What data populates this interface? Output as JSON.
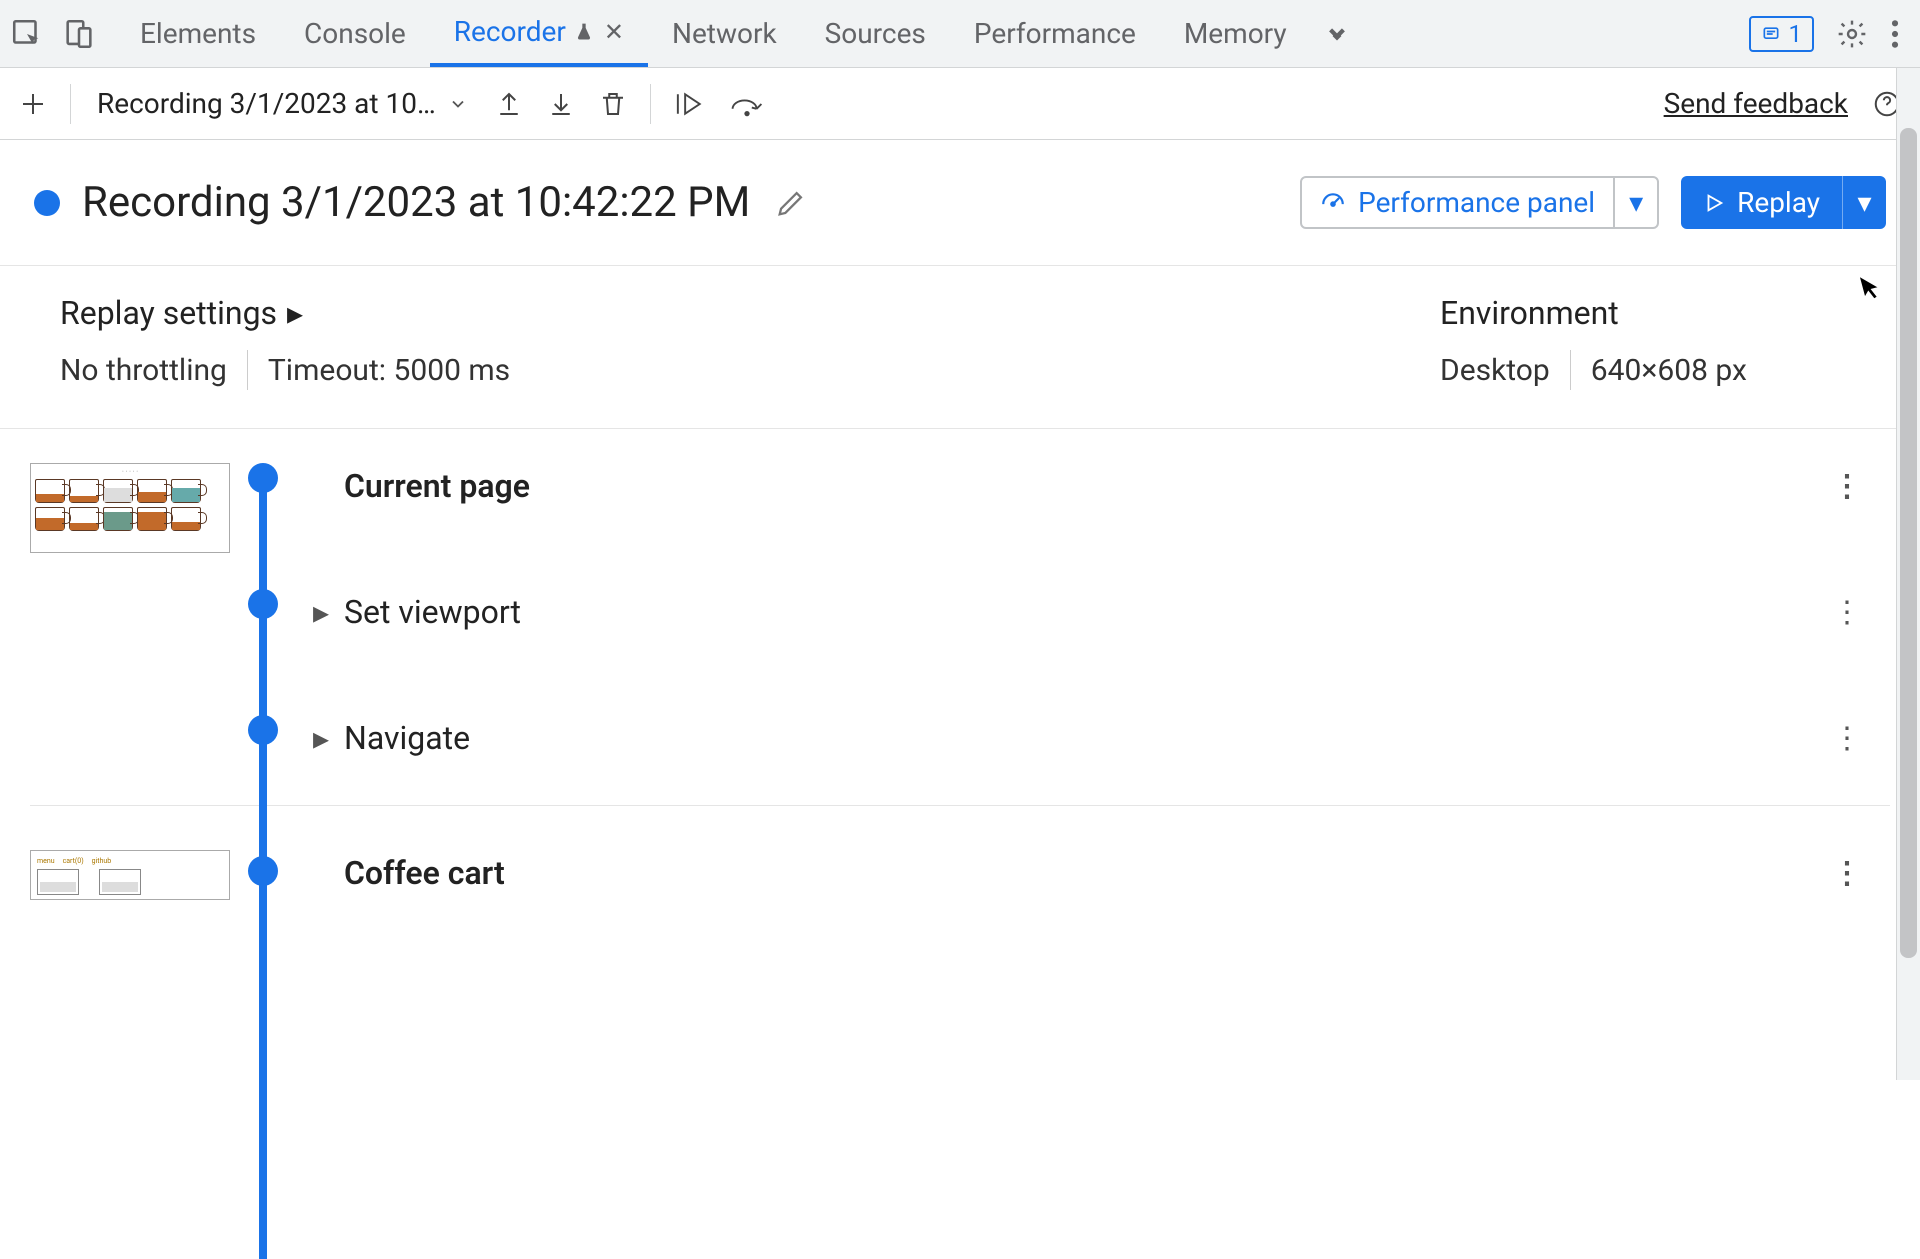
{
  "tabs": {
    "elements": "Elements",
    "console": "Console",
    "recorder": "Recorder",
    "network": "Network",
    "sources": "Sources",
    "performance": "Performance",
    "memory": "Memory"
  },
  "issues_count": "1",
  "toolbar": {
    "recording_select": "Recording 3/1/2023 at 10…",
    "feedback": "Send feedback"
  },
  "header": {
    "title": "Recording 3/1/2023 at 10:42:22 PM",
    "perf_label": "Performance panel",
    "replay_label": "Replay"
  },
  "settings": {
    "title": "Replay settings",
    "throttling": "No throttling",
    "timeout": "Timeout: 5000 ms",
    "env_title": "Environment",
    "env_device": "Desktop",
    "env_dims": "640×608 px"
  },
  "steps": {
    "current_page": "Current page",
    "set_viewport": "Set viewport",
    "navigate": "Navigate",
    "coffee_cart": "Coffee cart"
  }
}
